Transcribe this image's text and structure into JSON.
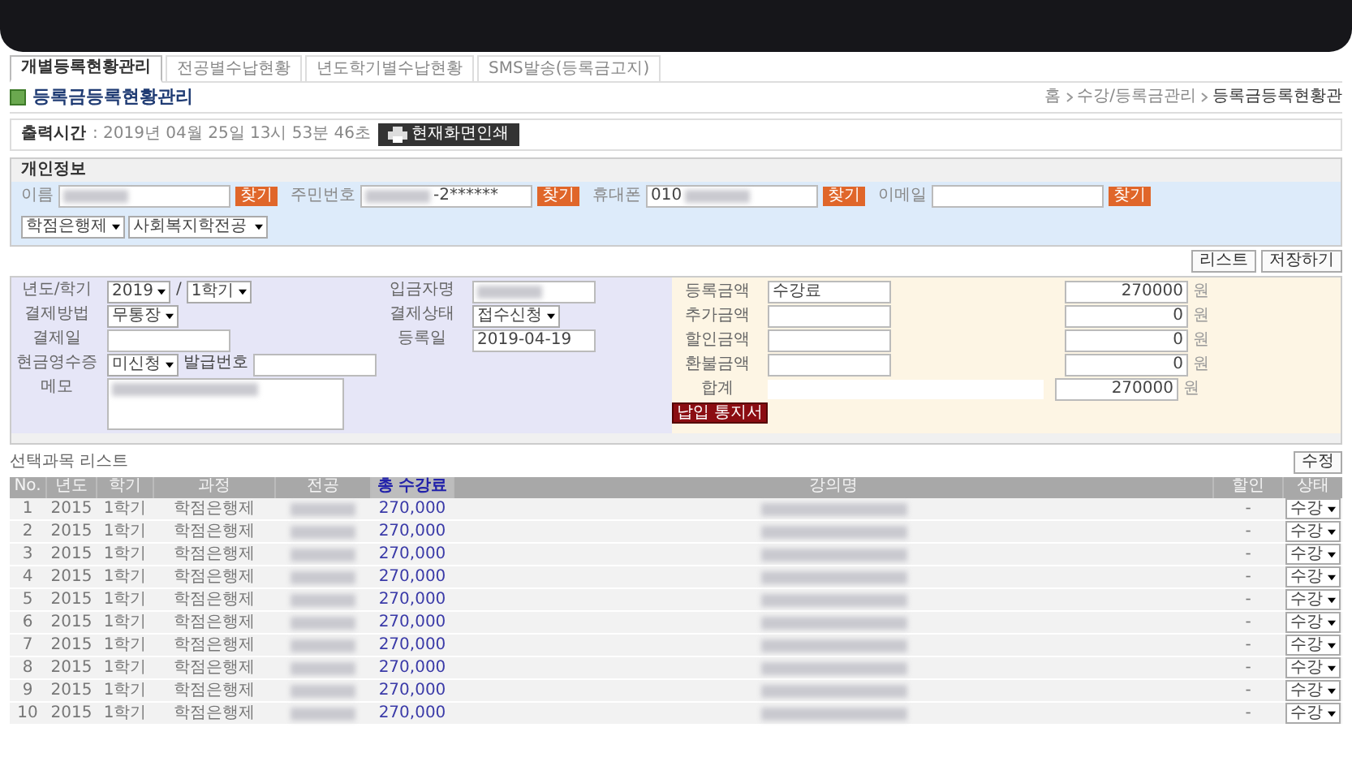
{
  "tabs": [
    {
      "label": "개별등록현황관리",
      "selected": true
    },
    {
      "label": "전공별수납현황",
      "selected": false
    },
    {
      "label": "년도학기별수납현황",
      "selected": false
    },
    {
      "label": "SMS발송(등록금고지)",
      "selected": false
    }
  ],
  "page_title": "등록금등록현황관리",
  "breadcrumb": [
    "홈",
    "수강/등록금관리",
    "등록금등록현황관"
  ],
  "print_bar": {
    "label": "출력시간",
    "value": ": 2019년 04월 25일 13시 53분 46초",
    "button": "현재화면인쇄"
  },
  "personal_info": {
    "title": "개인정보",
    "fields": [
      {
        "label": "이름",
        "parts": [
          {
            "kind": "redacted"
          }
        ],
        "button": "찾기"
      },
      {
        "label": "주민번호",
        "parts": [
          {
            "kind": "redacted"
          },
          {
            "kind": "text",
            "text": "-2******"
          }
        ],
        "button": "찾기"
      },
      {
        "label": "휴대폰",
        "parts": [
          {
            "kind": "text",
            "text": "010"
          },
          {
            "kind": "redacted"
          }
        ],
        "button": "찾기"
      },
      {
        "label": "이메일",
        "button": "찾기"
      }
    ],
    "selects": [
      "학점은행제",
      "사회복지학전공"
    ]
  },
  "actions": [
    "리스트",
    "저장하기"
  ],
  "payment_left": [
    {
      "label": "년도/학기",
      "controls": [
        {
          "kind": "select",
          "value": "2019"
        },
        {
          "kind": "text",
          "value": "/"
        },
        {
          "kind": "select",
          "value": "1학기"
        }
      ]
    },
    {
      "label": "결제방법",
      "controls": [
        {
          "kind": "select",
          "value": "무통장"
        }
      ]
    },
    {
      "label": "결제일",
      "controls": [
        {
          "kind": "input"
        }
      ]
    },
    {
      "label": "현금영수증",
      "controls": [
        {
          "kind": "select",
          "value": "미신청"
        },
        {
          "kind": "text",
          "value": "발급번호"
        },
        {
          "kind": "input"
        }
      ]
    },
    {
      "label": "메모",
      "controls": [
        {
          "kind": "textarea"
        }
      ]
    }
  ],
  "payment_middle": [
    {
      "label": "입금자명",
      "controls": [
        {
          "kind": "redacted-input"
        }
      ]
    },
    {
      "label": "결제상태",
      "controls": [
        {
          "kind": "select",
          "value": "접수신청"
        }
      ]
    },
    {
      "label": "등록일",
      "controls": [
        {
          "kind": "input",
          "value": "2019-04-19"
        }
      ]
    }
  ],
  "fees": [
    {
      "label": "등록금액",
      "kind": "input",
      "memo": "수강료",
      "amount": "270000",
      "unit": "원"
    },
    {
      "label": "추가금액",
      "kind": "input",
      "amount": "0",
      "unit": "원"
    },
    {
      "label": "할인금액",
      "kind": "input",
      "amount": "0",
      "unit": "원"
    },
    {
      "label": "환불금액",
      "kind": "input",
      "amount": "0",
      "unit": "원"
    },
    {
      "label": "합계",
      "kind": "total",
      "amount": "270000",
      "unit": "원"
    }
  ],
  "notice_button": "납입 통지서",
  "list": {
    "title": "선택과목 리스트",
    "button": "수정",
    "columns": [
      {
        "label": "No.",
        "kind": "text",
        "highlighted": false
      },
      {
        "label": "년도",
        "kind": "text",
        "highlighted": false
      },
      {
        "label": "학기",
        "kind": "text",
        "highlighted": false
      },
      {
        "label": "과정",
        "kind": "text",
        "highlighted": false
      },
      {
        "label": "전공",
        "kind": "redacted",
        "highlighted": false
      },
      {
        "label": "총 수강료",
        "kind": "amount",
        "highlighted": true
      },
      {
        "label": "강의명",
        "kind": "redacted",
        "highlighted": false
      },
      {
        "label": "할인",
        "kind": "text",
        "highlighted": false
      },
      {
        "label": "상태",
        "kind": "select",
        "highlighted": false
      }
    ],
    "rows": [
      [
        "1",
        "2015",
        "1학기",
        "학점은행제",
        null,
        "270,000",
        null,
        "-",
        "수강"
      ],
      [
        "2",
        "2015",
        "1학기",
        "학점은행제",
        null,
        "270,000",
        null,
        "-",
        "수강"
      ],
      [
        "3",
        "2015",
        "1학기",
        "학점은행제",
        null,
        "270,000",
        null,
        "-",
        "수강"
      ],
      [
        "4",
        "2015",
        "1학기",
        "학점은행제",
        null,
        "270,000",
        null,
        "-",
        "수강"
      ],
      [
        "5",
        "2015",
        "1학기",
        "학점은행제",
        null,
        "270,000",
        null,
        "-",
        "수강"
      ],
      [
        "6",
        "2015",
        "1학기",
        "학점은행제",
        null,
        "270,000",
        null,
        "-",
        "수강"
      ],
      [
        "7",
        "2015",
        "1학기",
        "학점은행제",
        null,
        "270,000",
        null,
        "-",
        "수강"
      ],
      [
        "8",
        "2015",
        "1학기",
        "학점은행제",
        null,
        "270,000",
        null,
        "-",
        "수강"
      ],
      [
        "9",
        "2015",
        "1학기",
        "학점은행제",
        null,
        "270,000",
        null,
        "-",
        "수강"
      ],
      [
        "10",
        "2015",
        "1학기",
        "학점은행제",
        null,
        "270,000",
        null,
        "-",
        "수강"
      ]
    ]
  }
}
